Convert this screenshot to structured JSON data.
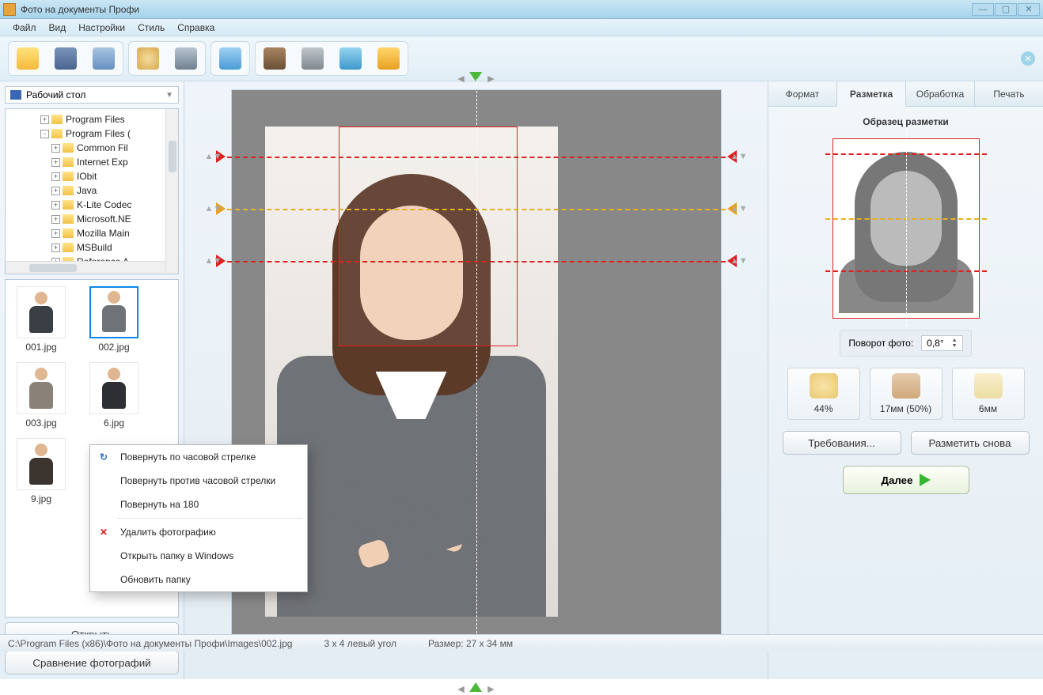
{
  "title": "Фото на документы Профи",
  "menu": [
    "Файл",
    "Вид",
    "Настройки",
    "Стиль",
    "Справка"
  ],
  "toolbar_icons": [
    "open",
    "save",
    "print",
    "find",
    "cam",
    "bg",
    "help",
    "video",
    "home",
    "cart"
  ],
  "path_combo": "Рабочий стол",
  "tree": [
    {
      "level": 3,
      "toggle": "+",
      "label": "Program Files"
    },
    {
      "level": 3,
      "toggle": "-",
      "label": "Program Files ("
    },
    {
      "level": 4,
      "toggle": "+",
      "label": "Common Fil"
    },
    {
      "level": 4,
      "toggle": "+",
      "label": "Internet Exp"
    },
    {
      "level": 4,
      "toggle": "+",
      "label": "IObit"
    },
    {
      "level": 4,
      "toggle": "+",
      "label": "Java"
    },
    {
      "level": 4,
      "toggle": "+",
      "label": "K-Lite Codec"
    },
    {
      "level": 4,
      "toggle": "+",
      "label": "Microsoft.NE"
    },
    {
      "level": 4,
      "toggle": "+",
      "label": "Mozilla Main"
    },
    {
      "level": 4,
      "toggle": "+",
      "label": "MSBuild"
    },
    {
      "level": 4,
      "toggle": "+",
      "label": "Reference A"
    }
  ],
  "thumbs": [
    {
      "file": "001.jpg",
      "color": "#3a3f46"
    },
    {
      "file": "002.jpg",
      "color": "#6f7277",
      "selected": true
    },
    {
      "file": "003.jpg",
      "color": "#8a8178"
    },
    {
      "file": "6.jpg",
      "color": "#2d2f33"
    },
    {
      "file": "9.jpg",
      "color": "#3b342f"
    }
  ],
  "btn_open": "Открыть",
  "btn_compare": "Сравнение фотографий",
  "ctx": {
    "rotate_cw": "Повернуть по часовой стрелке",
    "rotate_ccw": "Повернуть против часовой стрелки",
    "rotate_180": "Повернуть на 180",
    "delete": "Удалить фотографию",
    "open_folder": "Открыть папку в Windows",
    "refresh": "Обновить папку"
  },
  "tabs": [
    "Формат",
    "Разметка",
    "Обработка",
    "Печать"
  ],
  "active_tab": 1,
  "sample_title": "Образец разметки",
  "rotate_label": "Поворот фото:",
  "rotate_value": "0,8°",
  "metrics": [
    {
      "label": "44%"
    },
    {
      "label": "17мм (50%)"
    },
    {
      "label": "6мм"
    }
  ],
  "btn_requirements": "Требования...",
  "btn_remark": "Разметить снова",
  "btn_next": "Далее",
  "status": {
    "path": "C:\\Program Files (x86)\\Фото на документы Профи\\Images\\002.jpg",
    "format": "3 x 4 левый угол",
    "size": "Размер: 27 x 34 мм"
  }
}
